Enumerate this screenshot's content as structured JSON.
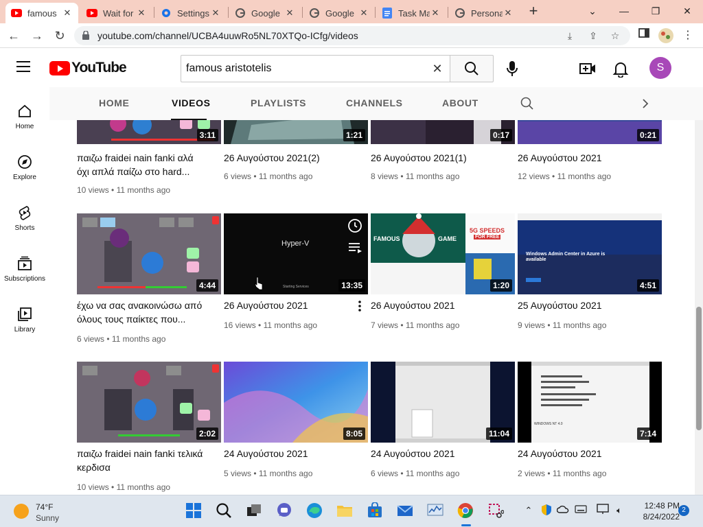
{
  "browser": {
    "tabs": [
      {
        "title": "famous",
        "icon": "youtube-icon"
      },
      {
        "title": "Wait for",
        "icon": "youtube-icon"
      },
      {
        "title": "Settings",
        "icon": "gear-icon"
      },
      {
        "title": "Google",
        "icon": "google-icon"
      },
      {
        "title": "Google",
        "icon": "google-icon"
      },
      {
        "title": "Task Ma",
        "icon": "docs-icon"
      },
      {
        "title": "Persona",
        "icon": "google-icon"
      }
    ],
    "url": "youtube.com/channel/UCBA4uuwRo5NL70XTQo-ICfg/videos"
  },
  "youtube": {
    "logo_text": "YouTube",
    "search_query": "famous aristotelis",
    "avatar_letter": "S",
    "guide": [
      {
        "label": "Home",
        "icon": "home-icon"
      },
      {
        "label": "Explore",
        "icon": "compass-icon"
      },
      {
        "label": "Shorts",
        "icon": "shorts-icon"
      },
      {
        "label": "Subscriptions",
        "icon": "subscriptions-icon"
      },
      {
        "label": "Library",
        "icon": "library-icon"
      }
    ],
    "channel_tabs": [
      "HOME",
      "VIDEOS",
      "PLAYLISTS",
      "CHANNELS",
      "ABOUT"
    ],
    "selected_tab": "VIDEOS",
    "videos": [
      {
        "title": "παιζω fraidei nain fanki αλά όχι απλά παίζω στο hard...",
        "views": "10 views",
        "age": "11 months ago",
        "duration": "3:11",
        "thumb": "fnf"
      },
      {
        "title": "26 Αυγούστου 2021(2)",
        "views": "6 views",
        "age": "11 months ago",
        "duration": "1:21",
        "thumb": "dark-teal"
      },
      {
        "title": "26 Αυγούστου 2021(1)",
        "views": "8 views",
        "age": "11 months ago",
        "duration": "0:17",
        "thumb": "dark-purple"
      },
      {
        "title": "26 Αυγούστου 2021",
        "views": "12 views",
        "age": "11 months ago",
        "duration": "0:21",
        "thumb": "blue-purple"
      },
      {
        "title": "έχω να σας ανακοινώσω από όλους τους παίκτες που...",
        "views": "6 views",
        "age": "11 months ago",
        "duration": "4:44",
        "thumb": "fnf"
      },
      {
        "title": "26 Αυγούστου 2021",
        "views": "16 views",
        "age": "11 months ago",
        "duration": "13:35",
        "thumb": "hyperv",
        "overlay_text": "Hyper-V",
        "overlay_sub": "Starting Services"
      },
      {
        "title": "26 Αυγούστου 2021",
        "views": "7 views",
        "age": "11 months ago",
        "duration": "1:20",
        "thumb": "gamebanner",
        "overlay_text": "FAMOUS",
        "overlay_text2": "GAME",
        "overlay_text3": "5G SPEEDS",
        "overlay_text4": "FOR FREE"
      },
      {
        "title": "25 Αυγούστου 2021",
        "views": "9 views",
        "age": "11 months ago",
        "duration": "4:51",
        "thumb": "azure",
        "overlay_text": "Windows Admin Center in Azure is available"
      },
      {
        "title": "παιζω fraidei nain fanki τελικά κερδισα",
        "views": "10 views",
        "age": "11 months ago",
        "duration": "2:02",
        "thumb": "fnf"
      },
      {
        "title": "24 Αυγούστου 2021",
        "views": "5 views",
        "age": "11 months ago",
        "duration": "8:05",
        "thumb": "wallpaper"
      },
      {
        "title": "24 Αυγούστου 2021",
        "views": "6 views",
        "age": "11 months ago",
        "duration": "11:04",
        "thumb": "setup"
      },
      {
        "title": "24 Αυγούστου 2021",
        "views": "2 views",
        "age": "11 months ago",
        "duration": "7:14",
        "thumb": "bios",
        "overlay_text": "WINDOWS NT 4.0"
      }
    ]
  },
  "taskbar": {
    "temperature": "74°F",
    "condition": "Sunny",
    "time": "12:48 PM",
    "date": "8/24/2022",
    "notifications": "2"
  },
  "colors": {
    "tabstrip": "#f6d0c4",
    "youtube_red": "#ff0000",
    "avatar": "#a848b8"
  }
}
